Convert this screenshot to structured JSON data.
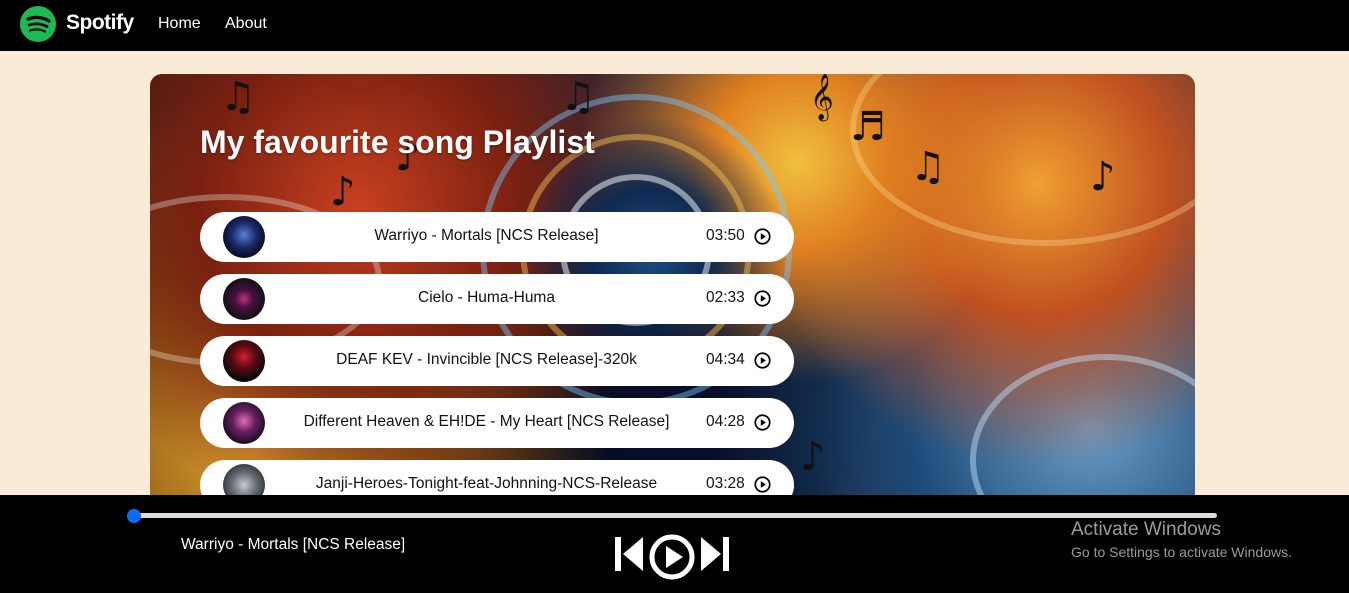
{
  "nav": {
    "brand": "Spotify",
    "links": [
      "Home",
      "About"
    ],
    "brand_color": "#1db954"
  },
  "playlist": {
    "title": "My favourite song Playlist",
    "songs": [
      {
        "name": "Warriyo - Mortals [NCS Release]",
        "duration": "03:50",
        "icon": "play-circle-icon"
      },
      {
        "name": "Cielo - Huma-Huma",
        "duration": "02:33",
        "icon": "play-circle-icon"
      },
      {
        "name": "DEAF KEV - Invincible [NCS Release]-320k",
        "duration": "04:34",
        "icon": "play-circle-icon"
      },
      {
        "name": "Different Heaven & EH!DE - My Heart [NCS Release]",
        "duration": "04:28",
        "icon": "play-circle-icon"
      },
      {
        "name": "Janji-Heroes-Tonight-feat-Johnning-NCS-Release",
        "duration": "03:28",
        "icon": "play-circle-icon"
      }
    ]
  },
  "player": {
    "now_playing": "Warriyo - Mortals [NCS Release]",
    "progress": 0,
    "accent": "#0a6cff"
  },
  "watermark": {
    "title": "Activate Windows",
    "subtitle": "Go to Settings to activate Windows."
  }
}
